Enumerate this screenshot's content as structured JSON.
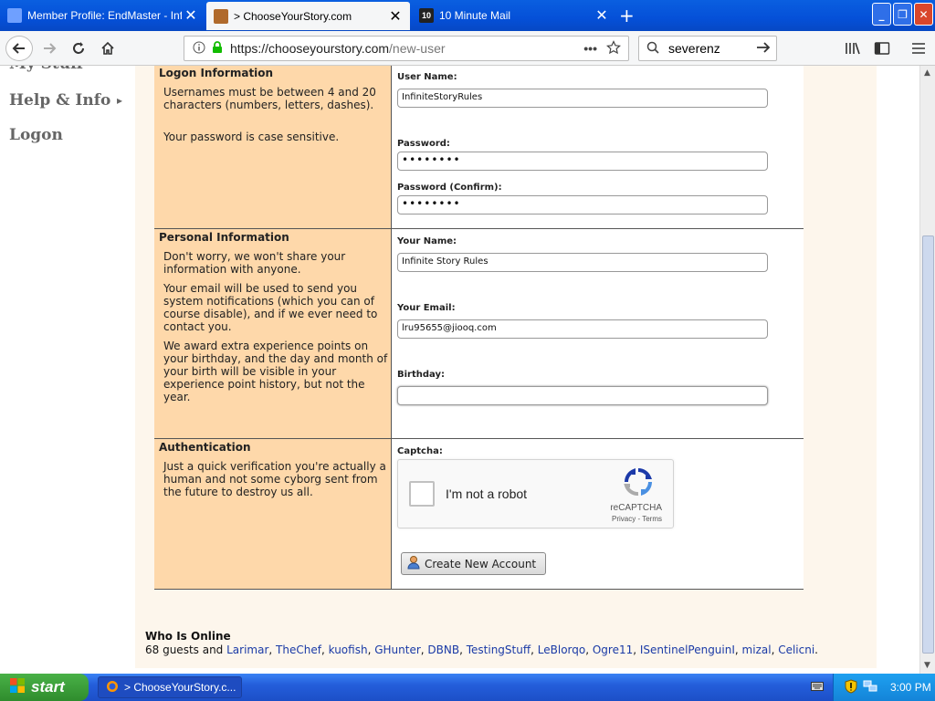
{
  "browser": {
    "tabs": [
      {
        "title": "Member Profile: EndMaster - Infin",
        "favicon": "infinite-story-favicon",
        "active": false
      },
      {
        "title": "> ChooseYourStory.com",
        "favicon": "cys-favicon",
        "active": true
      },
      {
        "title": "10 Minute Mail",
        "favicon": "ten-minute-mail-favicon",
        "favicon_text": "10",
        "active": false
      }
    ],
    "close_glyph": "✕",
    "newtab_glyph": "+",
    "url_host": "https://chooseyourstory.com",
    "url_path": "/new-user",
    "search_value": "severenz",
    "page_actions": "•••",
    "window_buttons": {
      "minimize": "_",
      "maximize": "❐",
      "close": "✕"
    }
  },
  "sidebar": {
    "items": [
      {
        "label": "My Stuff"
      },
      {
        "label": "Help & Info",
        "arrow": "▸"
      },
      {
        "label": "Logon"
      }
    ]
  },
  "sections": {
    "logon": {
      "title": "Logon Information",
      "text": [
        "Usernames must be between 4 and 20 characters (numbers, letters, dashes).",
        "Your password is case sensitive."
      ],
      "fields": {
        "username_label": "User Name:",
        "username_value": "InfiniteStoryRules",
        "password_label": "Password:",
        "password_value": "••••••••",
        "confirm_label": "Password (Confirm):",
        "confirm_value": "••••••••"
      }
    },
    "personal": {
      "title": "Personal Information",
      "text": [
        "Don't worry, we won't share your information with anyone.",
        "Your email will be used to send you system notifications (which you can of course disable), and if we ever need to contact you.",
        "We award extra experience points on your birthday, and the day and month of your birth will be visible in your experience point history, but not the year."
      ],
      "fields": {
        "name_label": "Your Name:",
        "name_value": "Infinite Story Rules",
        "email_label": "Your Email:",
        "email_value": "lru95655@jiooq.com",
        "birthday_label": "Birthday:",
        "birthday_value": ""
      }
    },
    "auth": {
      "title": "Authentication",
      "text": "Just a quick verification you're actually a human and not some cyborg sent from the future to destroy us all.",
      "captcha_label": "Captcha:",
      "recaptcha": {
        "label": "I'm not a robot",
        "brand": "reCAPTCHA",
        "terms": "Privacy - Terms"
      },
      "submit_label": "Create New Account"
    }
  },
  "who_online": {
    "title": "Who Is Online",
    "prefix": "68 guests and ",
    "users": [
      "Larimar",
      "TheChef",
      "kuofish",
      "GHunter",
      "DBNB",
      "TestingStuff",
      "LeBlorqo",
      "Ogre11",
      "ISentinelPenguinI",
      "mizal",
      "Celicni"
    ]
  },
  "taskbar": {
    "start_label": "start",
    "task_label": "> ChooseYourStory.c...",
    "clock": "3:00 PM"
  },
  "colors": {
    "label_bg": "#fed8aa",
    "content_bg": "#fdf6ec",
    "link": "#1a3aa6"
  }
}
